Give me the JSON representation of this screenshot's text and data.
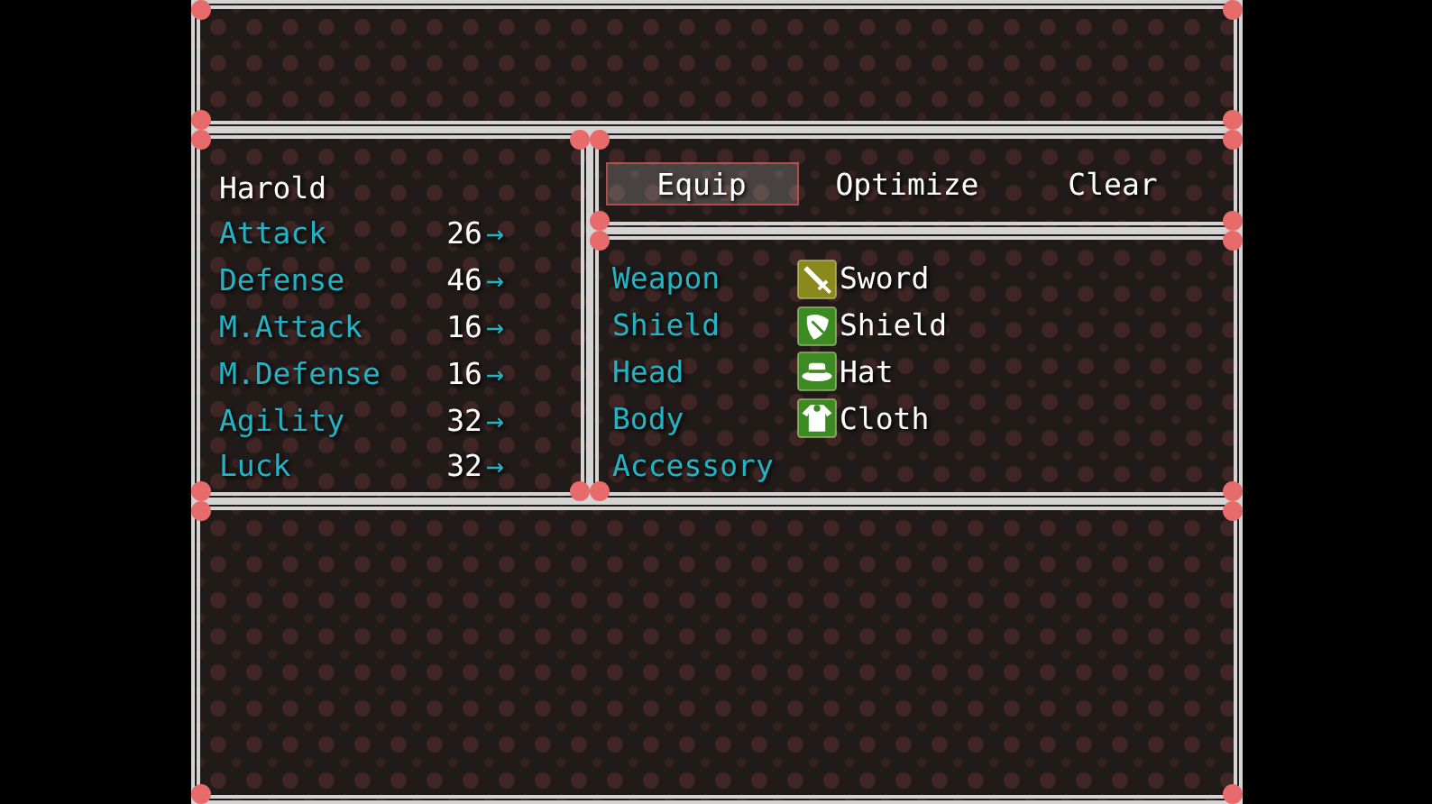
{
  "status": {
    "actor_name": "Harold",
    "params": [
      {
        "name": "Attack",
        "value": "26",
        "arrow": "→"
      },
      {
        "name": "Defense",
        "value": "46",
        "arrow": "→"
      },
      {
        "name": "M.Attack",
        "value": "16",
        "arrow": "→"
      },
      {
        "name": "M.Defense",
        "value": "16",
        "arrow": "→"
      },
      {
        "name": "Agility",
        "value": "32",
        "arrow": "→"
      },
      {
        "name": "Luck",
        "value": "32",
        "arrow": "→"
      }
    ]
  },
  "commands": [
    {
      "label": "Equip",
      "selected": true
    },
    {
      "label": "Optimize",
      "selected": false
    },
    {
      "label": "Clear",
      "selected": false
    }
  ],
  "slots": [
    {
      "label": "Weapon",
      "item": {
        "name": "Sword",
        "kind": "sword"
      }
    },
    {
      "label": "Shield",
      "item": {
        "name": "Shield",
        "kind": "shield"
      }
    },
    {
      "label": "Head",
      "item": {
        "name": "Hat",
        "kind": "hat"
      }
    },
    {
      "label": "Body",
      "item": {
        "name": "Cloth",
        "kind": "cloth"
      }
    },
    {
      "label": "Accessory"
    }
  ]
}
